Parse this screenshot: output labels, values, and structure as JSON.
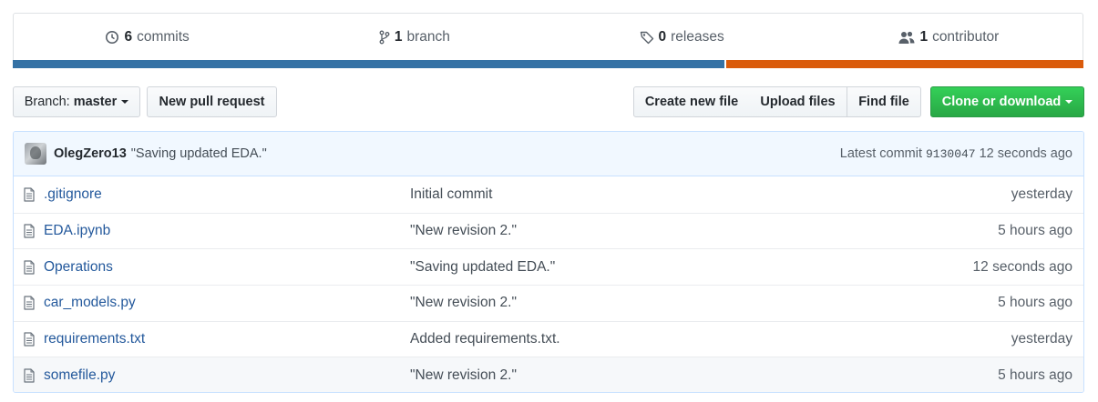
{
  "summary": {
    "commits": {
      "count": "6",
      "label": "commits",
      "icon": "history-icon"
    },
    "branches": {
      "count": "1",
      "label": "branch",
      "icon": "branch-icon"
    },
    "releases": {
      "count": "0",
      "label": "releases",
      "icon": "tag-icon"
    },
    "contributors": {
      "count": "1",
      "label": "contributor",
      "icon": "people-icon"
    },
    "language_bar": [
      {
        "color": "#3572a5",
        "fraction": 0.665
      },
      {
        "color": "#da5b0b",
        "fraction": 0.335
      }
    ]
  },
  "toolbar": {
    "branch_prefix": "Branch:",
    "branch_name": "master",
    "new_pr": "New pull request",
    "create_file": "Create new file",
    "upload_files": "Upload files",
    "find_file": "Find file",
    "clone": "Clone or download"
  },
  "latest_commit": {
    "author": "OlegZero13",
    "message": "\"Saving updated EDA.\"",
    "prefix": "Latest commit",
    "sha": "9130047",
    "age": "12 seconds ago"
  },
  "files": [
    {
      "name": ".gitignore",
      "message": "Initial commit",
      "age": "yesterday"
    },
    {
      "name": "EDA.ipynb",
      "message": "\"New revision 2.\"",
      "age": "5 hours ago"
    },
    {
      "name": "Operations",
      "message": "\"Saving updated EDA.\"",
      "age": "12 seconds ago"
    },
    {
      "name": "car_models.py",
      "message": "\"New revision 2.\"",
      "age": "5 hours ago"
    },
    {
      "name": "requirements.txt",
      "message": "Added requirements.txt.",
      "age": "yesterday"
    },
    {
      "name": "somefile.py",
      "message": "\"New revision 2.\"",
      "age": "5 hours ago"
    }
  ],
  "colors": {
    "accent_link": "#24599c",
    "green": "#28a745"
  }
}
